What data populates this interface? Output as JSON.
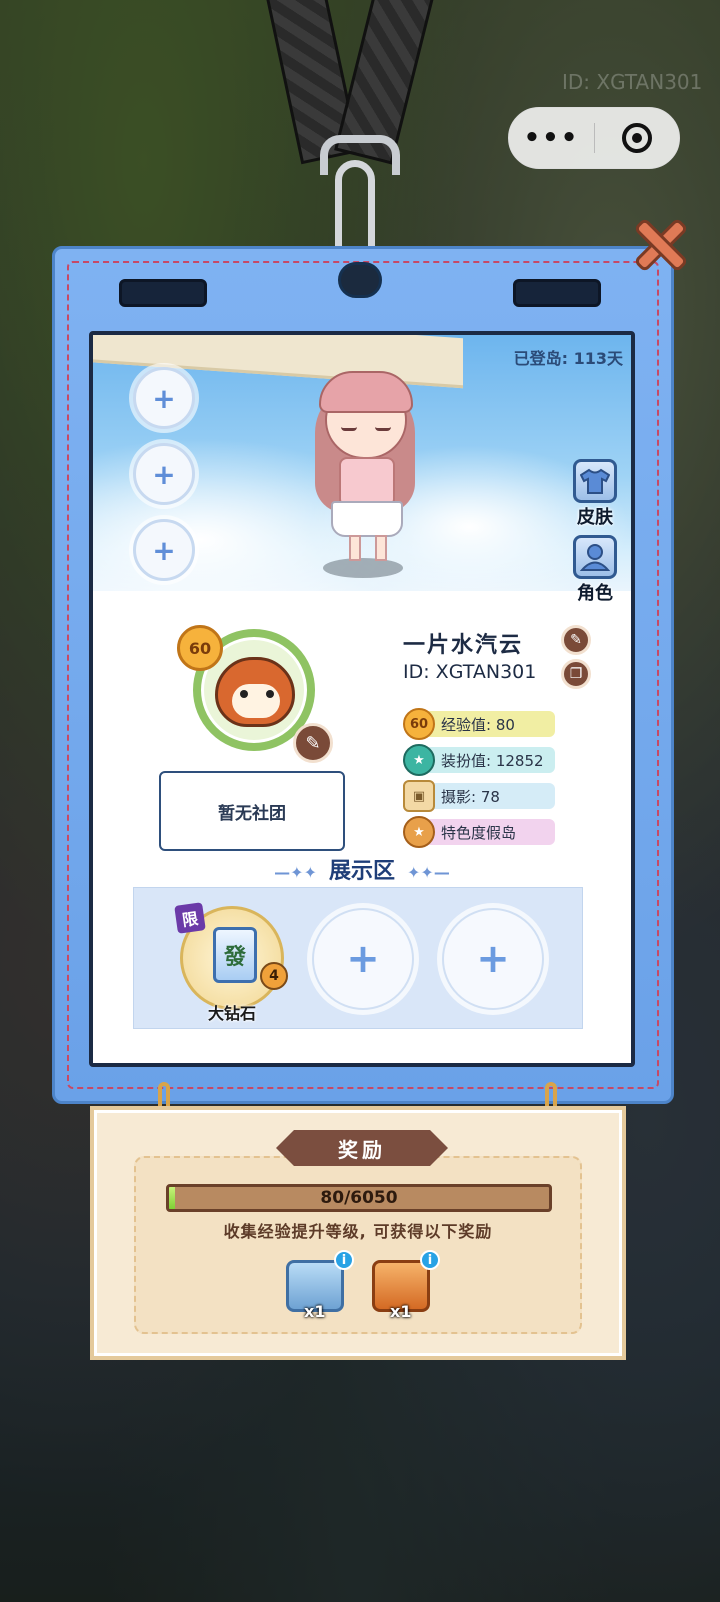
{
  "watermark_id": "ID: XGTAN301",
  "capsule": {
    "more_label": "•••",
    "close_icon": "target-icon"
  },
  "scene": {
    "days_on_island": "已登岛: 113天"
  },
  "side_buttons": [
    {
      "label": "皮肤",
      "icon": "shirt-icon"
    },
    {
      "label": "角色",
      "icon": "person-icon"
    }
  ],
  "empty_slots": [
    "+",
    "+",
    "+"
  ],
  "profile": {
    "level": "60",
    "nickname": "一片水汽云",
    "uid": "ID: XGTAN301",
    "club": "暂无社团",
    "stats": [
      {
        "badge": "60",
        "label": "经验值: 80",
        "color": "#f1eea3"
      },
      {
        "badge": "★",
        "label": "装扮值: 12852",
        "color": "#cbeef0"
      },
      {
        "badge": "▣",
        "label": "摄影: 78",
        "color": "#d5ecf7"
      },
      {
        "badge": "★",
        "label": "特色度假岛",
        "color": "#f2d3ee"
      }
    ]
  },
  "showcase": {
    "title": "展示区",
    "deco_left": "—✦✦",
    "deco_right": "✦✦—",
    "items": [
      {
        "name": "大钻石",
        "tag": "限",
        "glyph": "發",
        "count": "4"
      },
      {
        "name": "",
        "placeholder": "+"
      },
      {
        "name": "",
        "placeholder": "+"
      }
    ]
  },
  "reward": {
    "title": "奖励",
    "progress_text": "80/6050",
    "progress_fraction": 0.0132,
    "description": "收集经验提升等级, 可获得以下奖励",
    "items": [
      {
        "icon": "energy-box-icon",
        "count": "x1",
        "color": "#8fc0e8"
      },
      {
        "icon": "treasure-chest-icon",
        "count": "x1",
        "color": "#e98a3a"
      }
    ]
  }
}
